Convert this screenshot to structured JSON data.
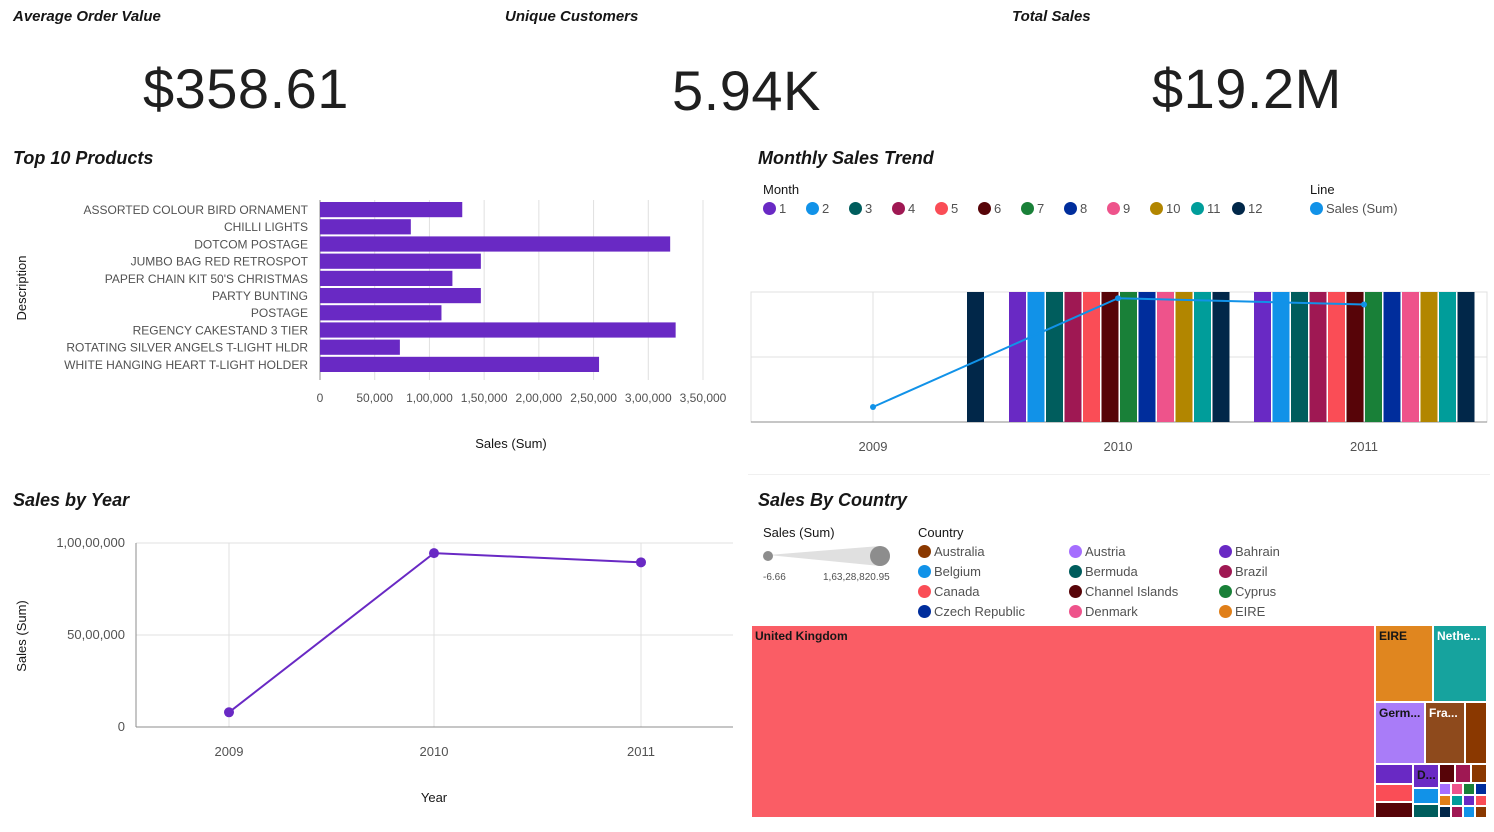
{
  "kpis": [
    {
      "title": "Average Order Value",
      "value": "$358.61"
    },
    {
      "title": "Unique Customers",
      "value": "5.94K"
    },
    {
      "title": "Total Sales",
      "value": "$19.2M"
    }
  ],
  "sections": {
    "top_products": "Top 10 Products",
    "monthly_trend": "Monthly Sales Trend",
    "sales_by_year": "Sales by Year",
    "sales_by_country": "Sales By Country"
  },
  "chart_data": [
    {
      "id": "top10",
      "type": "bar",
      "orientation": "horizontal",
      "title": "Top 10 Products",
      "xlabel": "Sales (Sum)",
      "ylabel": "Description",
      "categories": [
        "ASSORTED COLOUR BIRD ORNAMENT",
        "CHILLI LIGHTS",
        "DOTCOM POSTAGE",
        "JUMBO BAG RED RETROSPOT",
        "PAPER CHAIN KIT 50'S CHRISTMAS",
        "PARTY BUNTING",
        "POSTAGE",
        "REGENCY CAKESTAND 3 TIER",
        "ROTATING SILVER ANGELS T-LIGHT HLDR",
        "WHITE HANGING HEART T-LIGHT HOLDER"
      ],
      "values": [
        130000,
        83000,
        320000,
        147000,
        121000,
        147000,
        111000,
        325000,
        73000,
        255000
      ],
      "xlim": [
        0,
        350000
      ],
      "xticks": [
        0,
        50000,
        100000,
        150000,
        200000,
        250000,
        300000,
        350000
      ],
      "xtick_labels": [
        "0",
        "50,000",
        "1,00,000",
        "1,50,000",
        "2,00,000",
        "2,50,000",
        "3,00,000",
        "3,50,000"
      ],
      "color": "#6929c4",
      "grid": true
    },
    {
      "id": "monthly",
      "type": "bar",
      "title": "Monthly Sales Trend",
      "legend_month_title": "Month",
      "legend_line_title": "Line",
      "line_series_name": "Sales (Sum)",
      "months": [
        "1",
        "2",
        "3",
        "4",
        "5",
        "6",
        "7",
        "8",
        "9",
        "10",
        "11",
        "12"
      ],
      "month_colors": [
        "#6929c4",
        "#1192e8",
        "#005d5d",
        "#9f1853",
        "#fa4d56",
        "#570408",
        "#198038",
        "#002d9c",
        "#ee538b",
        "#b28600",
        "#009d9a",
        "#012749"
      ],
      "years": [
        "2009",
        "2010",
        "2011"
      ],
      "bar_groups": [
        {
          "year": "2009",
          "months": [
            12
          ]
        },
        {
          "year": "2010",
          "months": [
            1,
            2,
            3,
            4,
            5,
            6,
            7,
            8,
            9,
            10,
            11,
            12
          ]
        },
        {
          "year": "2011",
          "months": [
            1,
            2,
            3,
            4,
            5,
            6,
            7,
            8,
            9,
            10,
            11,
            12
          ]
        }
      ],
      "line_values": [
        800000,
        9500000,
        9000000
      ],
      "line_color": "#1192e8",
      "grid": true
    },
    {
      "id": "yearly",
      "type": "line",
      "title": "Sales by Year",
      "xlabel": "Year",
      "ylabel": "Sales (Sum)",
      "x": [
        "2009",
        "2010",
        "2011"
      ],
      "values": [
        800000,
        9450000,
        8950000
      ],
      "ylim": [
        0,
        10000000
      ],
      "yticks": [
        0,
        5000000,
        10000000
      ],
      "ytick_labels": [
        "0",
        "50,00,000",
        "1,00,00,000"
      ],
      "color": "#6929c4",
      "grid": true
    },
    {
      "id": "country",
      "type": "treemap",
      "title": "Sales By Country",
      "size_legend_title": "Sales (Sum)",
      "size_min_label": "-6.66",
      "size_max_label": "1,63,28,820.95",
      "legend_title": "Country",
      "legend": [
        {
          "name": "Australia",
          "color": "#8a3800"
        },
        {
          "name": "Austria",
          "color": "#a56eff"
        },
        {
          "name": "Bahrain",
          "color": "#6929c4"
        },
        {
          "name": "Belgium",
          "color": "#1192e8"
        },
        {
          "name": "Bermuda",
          "color": "#005d5d"
        },
        {
          "name": "Brazil",
          "color": "#9f1853"
        },
        {
          "name": "Canada",
          "color": "#fa4d56"
        },
        {
          "name": "Channel Islands",
          "color": "#570408"
        },
        {
          "name": "Cyprus",
          "color": "#198038"
        },
        {
          "name": "Czech Republic",
          "color": "#002d9c"
        },
        {
          "name": "Denmark",
          "color": "#ee538b"
        },
        {
          "name": "EIRE",
          "color": "#e07f19"
        }
      ],
      "tiles": [
        {
          "label": "United Kingdom",
          "color": "#fa5d65"
        },
        {
          "label": "EIRE",
          "color": "#e0861f"
        },
        {
          "label": "Nethe...",
          "color": "#16a39e"
        },
        {
          "label": "Germ...",
          "color": "#a97cf8"
        },
        {
          "label": "Fra...",
          "color": "#8e4a1c"
        },
        {
          "label": "D...",
          "color": "#6a2bc4"
        }
      ]
    }
  ]
}
